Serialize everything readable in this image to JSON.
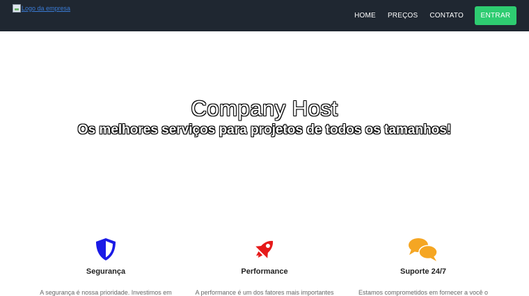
{
  "navbar": {
    "logo_alt": "Logo da empresa",
    "links": [
      "HOME",
      "PREÇOS",
      "CONTATO"
    ],
    "cta_label": "ENTRAR",
    "colors": {
      "background": "#1f2731",
      "cta": "#2ecc71"
    }
  },
  "hero": {
    "title": "Company Host",
    "subtitle": "Os melhores serviços para projetos de todos os tamanhos!"
  },
  "features": [
    {
      "icon": "shield-icon",
      "title": "Segurança",
      "text": "A segurança é nossa prioridade. Investimos em",
      "color": "#1a1ae6"
    },
    {
      "icon": "rocket-icon",
      "title": "Performance",
      "text": "A performance é um dos fatores mais importantes",
      "color": "#e61a1a"
    },
    {
      "icon": "chat-bubbles-icon",
      "title": "Suporte 24/7",
      "text": "Estamos comprometidos em fornecer a você o",
      "color": "#f5a623"
    }
  ]
}
